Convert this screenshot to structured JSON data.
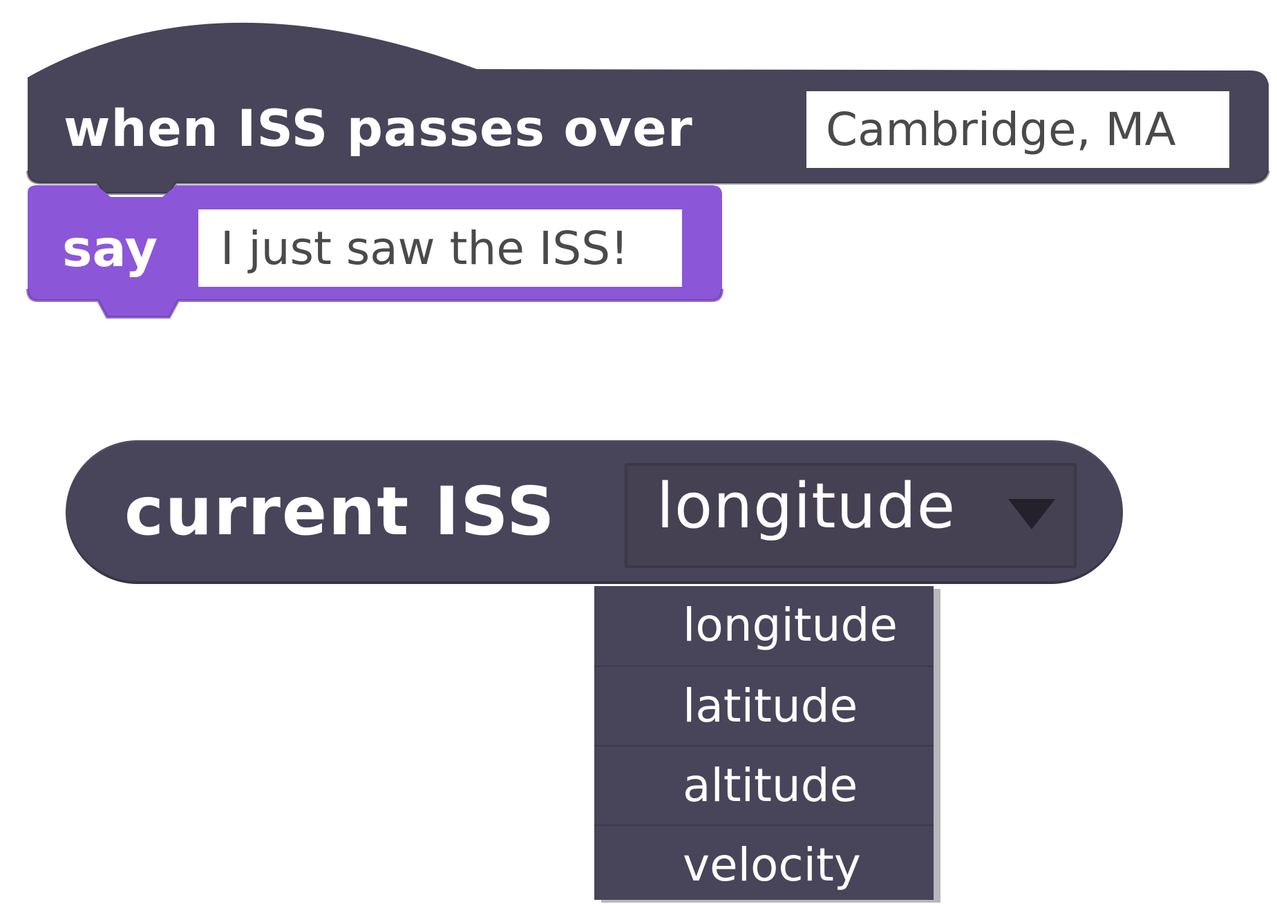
{
  "hat_block": {
    "label": "when ISS passes over",
    "location_value": "Cambridge, MA",
    "color": "#484459"
  },
  "say_block": {
    "label": "say",
    "message_value": "I just saw the ISS!",
    "color": "#8c56d8"
  },
  "reporter_block": {
    "label": "current ISS",
    "selected_option": "longitude",
    "color": "#484459"
  },
  "dropdown_menu": {
    "items": [
      {
        "label": "longitude"
      },
      {
        "label": "latitude"
      },
      {
        "label": "altitude"
      },
      {
        "label": "velocity"
      }
    ]
  }
}
